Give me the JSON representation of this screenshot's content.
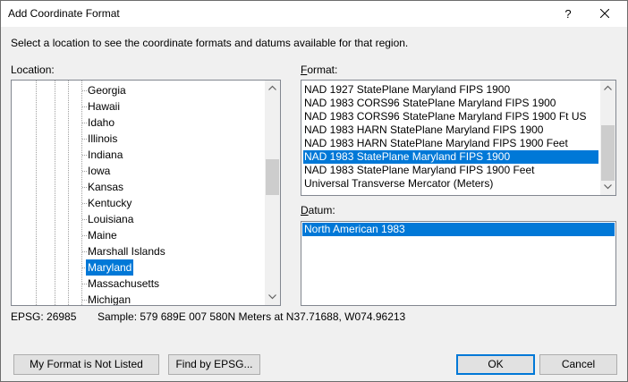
{
  "dialog": {
    "title": "Add Coordinate Format",
    "help_label": "?",
    "instruction": "Select a location to see the coordinate formats and datums available for that region."
  },
  "location": {
    "label_prefix": "",
    "label_rest": "Location:",
    "items": [
      "Georgia",
      "Hawaii",
      "Idaho",
      "Illinois",
      "Indiana",
      "Iowa",
      "Kansas",
      "Kentucky",
      "Louisiana",
      "Maine",
      "Marshall Islands",
      "Maryland",
      "Massachusetts",
      "Michigan"
    ],
    "selected": "Maryland"
  },
  "format": {
    "label_accel": "F",
    "label_rest": "ormat:",
    "items": [
      "NAD 1927 StatePlane Maryland FIPS 1900",
      "NAD 1983 CORS96 StatePlane Maryland FIPS 1900",
      "NAD 1983 CORS96 StatePlane Maryland FIPS 1900 Ft US",
      "NAD 1983 HARN StatePlane Maryland FIPS 1900",
      "NAD 1983 HARN StatePlane Maryland FIPS 1900 Feet",
      "NAD 1983 StatePlane Maryland FIPS 1900",
      "NAD 1983 StatePlane Maryland FIPS 1900 Feet",
      "Universal Transverse Mercator (Meters)"
    ],
    "selected": "NAD 1983 StatePlane Maryland FIPS 1900"
  },
  "datum": {
    "label_accel": "D",
    "label_rest": "atum:",
    "items": [
      "North American 1983"
    ]
  },
  "status": {
    "epsg": "EPSG: 26985",
    "sample": "Sample: 579 689E  007 580N Meters at N37.71688, W074.96213"
  },
  "buttons": {
    "not_listed": "My Format is Not Listed",
    "find_epsg": "Find by EPSG...",
    "ok": "OK",
    "cancel": "Cancel"
  },
  "colors": {
    "selection": "#0078d7",
    "window_bg": "#f0f0f0"
  },
  "icons": {
    "close": "close-icon",
    "scroll_up": "chevron-up-icon",
    "scroll_down": "chevron-down-icon"
  }
}
